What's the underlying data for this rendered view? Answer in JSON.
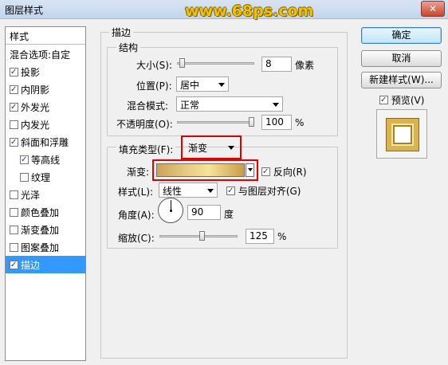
{
  "window": {
    "title": "图层样式",
    "watermark": "www.68ps.com",
    "close_glyph": "✕"
  },
  "style_list": {
    "header": "样式",
    "items": [
      {
        "label": "混合选项:自定",
        "checkbox": false,
        "checked": false,
        "selected": false,
        "sub": false
      },
      {
        "label": "投影",
        "checkbox": true,
        "checked": true,
        "selected": false,
        "sub": false
      },
      {
        "label": "内阴影",
        "checkbox": true,
        "checked": true,
        "selected": false,
        "sub": false
      },
      {
        "label": "外发光",
        "checkbox": true,
        "checked": true,
        "selected": false,
        "sub": false
      },
      {
        "label": "内发光",
        "checkbox": true,
        "checked": false,
        "selected": false,
        "sub": false
      },
      {
        "label": "斜面和浮雕",
        "checkbox": true,
        "checked": true,
        "selected": false,
        "sub": false
      },
      {
        "label": "等高线",
        "checkbox": true,
        "checked": true,
        "selected": false,
        "sub": true
      },
      {
        "label": "纹理",
        "checkbox": true,
        "checked": false,
        "selected": false,
        "sub": true
      },
      {
        "label": "光泽",
        "checkbox": true,
        "checked": false,
        "selected": false,
        "sub": false
      },
      {
        "label": "颜色叠加",
        "checkbox": true,
        "checked": false,
        "selected": false,
        "sub": false
      },
      {
        "label": "渐变叠加",
        "checkbox": true,
        "checked": false,
        "selected": false,
        "sub": false
      },
      {
        "label": "图案叠加",
        "checkbox": true,
        "checked": false,
        "selected": false,
        "sub": false
      },
      {
        "label": "描边",
        "checkbox": true,
        "checked": true,
        "selected": true,
        "sub": false
      }
    ]
  },
  "stroke": {
    "section_title": "描边",
    "structure": {
      "title": "结构",
      "size_label": "大小(S):",
      "size_value": "8",
      "size_unit": "像素",
      "size_slider": 0.03,
      "position_label": "位置(P):",
      "position_value": "居中",
      "blend_label": "混合模式:",
      "blend_value": "正常",
      "opacity_label": "不透明度(O):",
      "opacity_value": "100",
      "opacity_unit": "%",
      "opacity_slider": 1.0
    },
    "fill": {
      "type_label": "填充类型(F):",
      "type_value": "渐变",
      "gradient_label": "渐变:",
      "reverse_label": "反向(R)",
      "reverse_checked": true,
      "style_label": "样式(L):",
      "style_value": "线性",
      "align_label": "与图层对齐(G)",
      "align_checked": true,
      "angle_label": "角度(A):",
      "angle_value": "90",
      "angle_unit": "度",
      "scale_label": "缩放(C):",
      "scale_value": "125",
      "scale_unit": "%",
      "scale_slider": 0.55
    }
  },
  "buttons": {
    "ok": "确定",
    "cancel": "取消",
    "new_style": "新建样式(W)...",
    "preview_label": "预览(V)",
    "preview_checked": true
  },
  "colors": {
    "selection": "#3399ff",
    "highlight": "#e00000",
    "gold": "#d8b350"
  }
}
